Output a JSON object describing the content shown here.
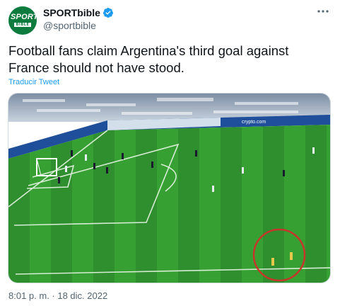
{
  "author": {
    "display_name": "SPORTbible",
    "handle": "@sportbible",
    "verified": true,
    "avatar_text_top": "SPORT",
    "avatar_text_bottom": "BIBLE",
    "avatar_color": "#0d7a3e"
  },
  "tweet": {
    "text": "Football fans claim Argentina's third goal against France should not have stood.",
    "translate_label": "Traducir Tweet",
    "timestamp": "8:01 p. m. · 18 dic. 2022"
  },
  "media": {
    "description_icon": "video-still",
    "board_text": "crypto.com",
    "pitch_color": "#2f8f2e",
    "highlight_color": "#c8362b"
  },
  "icons": {
    "verified": "verified-badge-icon",
    "more": "more-options-icon"
  },
  "colors": {
    "link": "#1d9bf0",
    "verified": "#1d9bf0",
    "secondary_text": "#536471"
  }
}
